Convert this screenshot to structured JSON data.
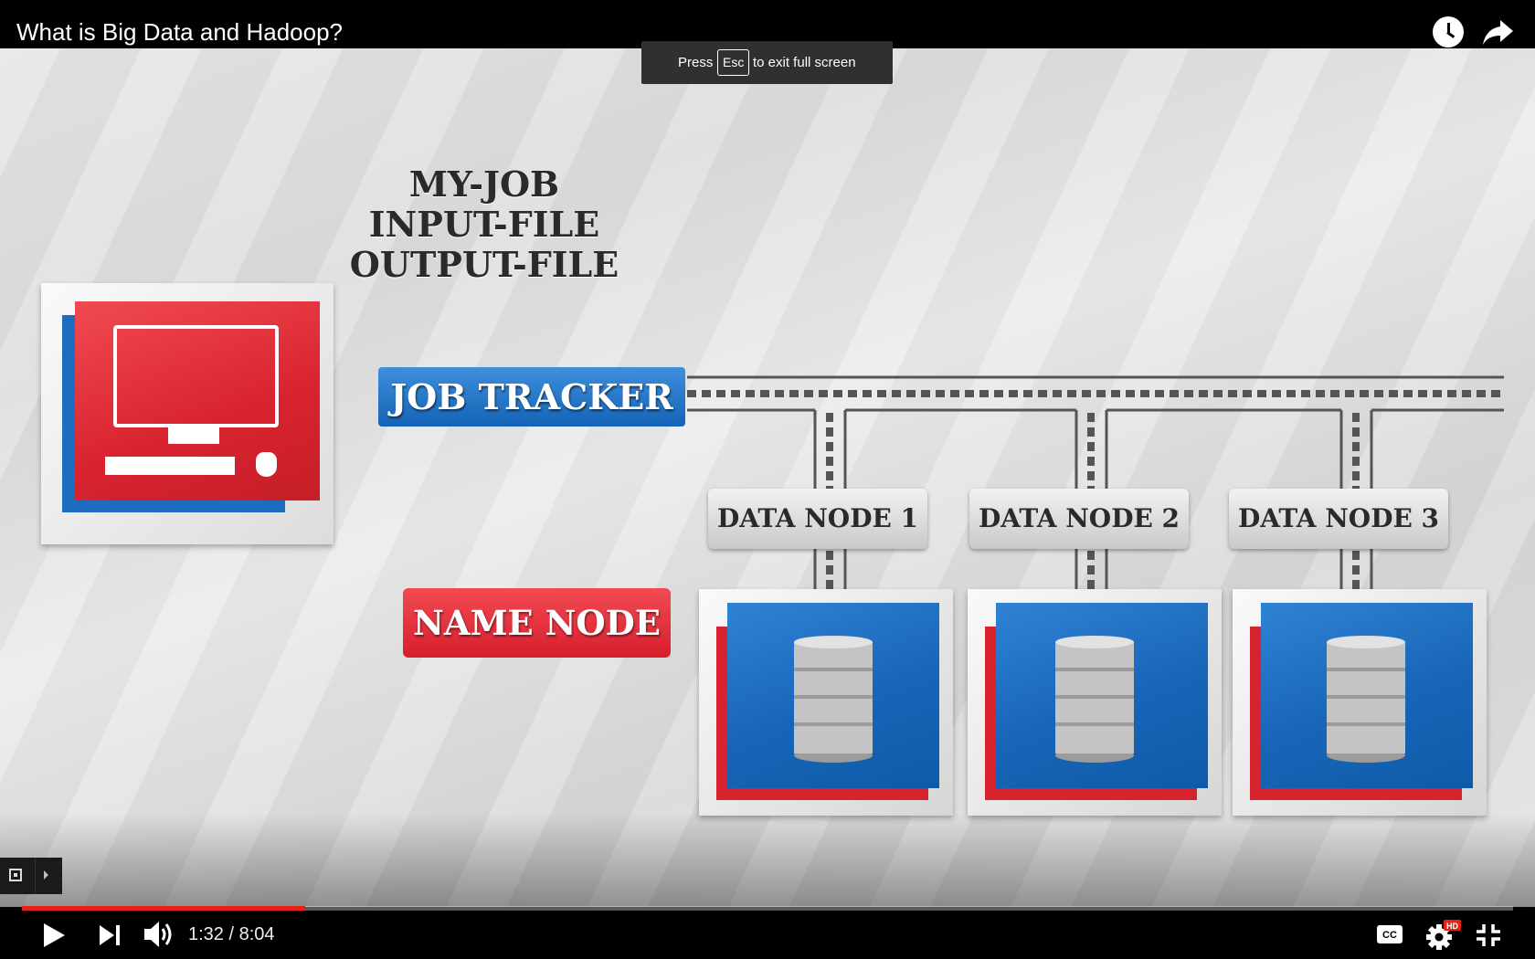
{
  "header": {
    "video_title": "What is Big Data and Hadoop?",
    "actions": [
      {
        "icon": "clock-icon",
        "name": "watch-later"
      },
      {
        "icon": "share-arrow-icon",
        "name": "share"
      }
    ]
  },
  "fullscreen_notice": {
    "prefix": "Press",
    "key": "Esc",
    "suffix": "to exit full screen"
  },
  "diagram": {
    "job_lines": [
      "MY-JOB",
      "INPUT-FILE",
      "OUTPUT-FILE"
    ],
    "job_tracker": "JOB TRACKER",
    "name_node": "NAME NODE",
    "data_nodes": [
      "DATA NODE 1",
      "DATA NODE 2",
      "DATA NODE 3"
    ],
    "colors": {
      "red": "#d8232f",
      "blue": "#1865b8",
      "background": "#e2e2e2"
    }
  },
  "player": {
    "current_time": "1:32",
    "duration": "8:04",
    "time_display": "1:32 / 8:04",
    "progress_fraction": 0.19,
    "played_color": "#e62117",
    "hd_badge": "HD",
    "controls": [
      "play-icon",
      "next-icon",
      "volume-icon",
      "cc-icon",
      "settings-gear-icon",
      "exit-fullscreen-icon"
    ]
  }
}
